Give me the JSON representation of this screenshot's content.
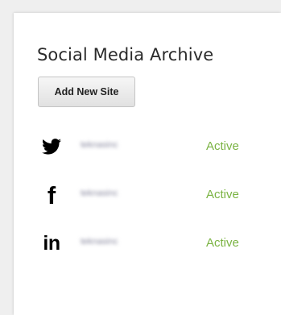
{
  "panel": {
    "title": "Social Media Archive",
    "add_button_label": "Add New Site"
  },
  "sites": [
    {
      "network": "Twitter",
      "icon": "twitter-bird-icon",
      "account": "teknasinc",
      "status": "Active"
    },
    {
      "network": "Facebook",
      "icon": "facebook-f-icon",
      "glyph": "f",
      "account": "teknasinc",
      "status": "Active"
    },
    {
      "network": "LinkedIn",
      "icon": "linkedin-in-icon",
      "glyph": "in",
      "account": "teknasinc",
      "status": "Active"
    }
  ],
  "colors": {
    "status_active": "#7ab342",
    "title_text": "#2b2b2b",
    "background": "#efefef",
    "card": "#ffffff"
  }
}
